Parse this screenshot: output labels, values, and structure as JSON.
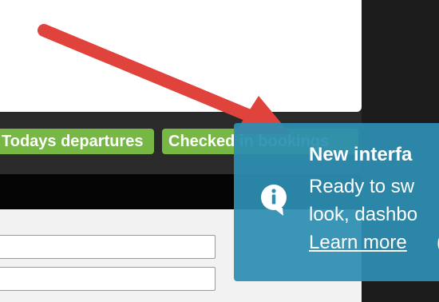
{
  "tabs": [
    {
      "label": "Todays departures"
    },
    {
      "label": "Checked in bookings"
    }
  ],
  "notification": {
    "icon": "info-speech-bubble-icon",
    "title": "New interfa",
    "line1": "Ready to sw",
    "line2": "look, dashbo",
    "link": "Learn more",
    "trailing": "("
  },
  "colors": {
    "tab_green": "#76b843",
    "toast_blue": "#2c8eb2",
    "arrow_red": "#e0423c"
  }
}
